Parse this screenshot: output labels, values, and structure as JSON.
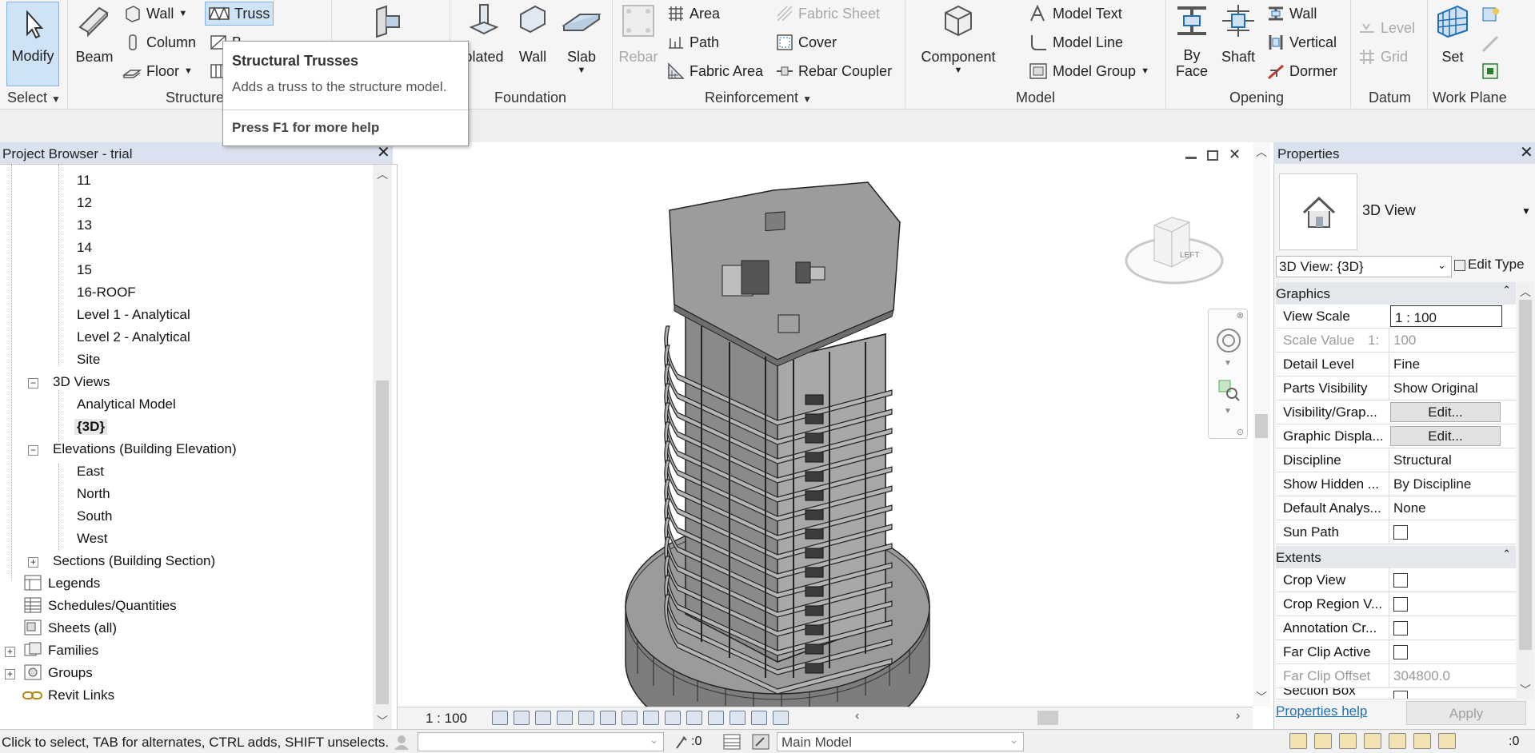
{
  "ribbon": {
    "select": {
      "modify_label": "Modify",
      "panel_label": "Select"
    },
    "structure": {
      "beam_label": "Beam",
      "wall_label": "Wall",
      "column_label": "Column",
      "floor_label": "Floor",
      "truss_label": "Truss",
      "brace_label_partial": "B",
      "panel_label": "Structure"
    },
    "foundation": {
      "isolated_label": "olated",
      "wall_label": "Wall",
      "slab_label": "Slab",
      "panel_label": "Foundation"
    },
    "reinforcement": {
      "rebar_label": "Rebar",
      "area_label": "Area",
      "path_label": "Path",
      "fabric_area_label": "Fabric  Area",
      "fabric_sheet_label": "Fabric  Sheet",
      "cover_label": "Cover",
      "rebar_coupler_label": "Rebar  Coupler",
      "panel_label": "Reinforcement"
    },
    "model": {
      "component_label": "Component",
      "model_text_label": "Model  Text",
      "model_line_label": "Model  Line",
      "model_group_label": "Model  Group",
      "panel_label": "Model"
    },
    "opening": {
      "by_face_label1": "By",
      "by_face_label2": "Face",
      "shaft_label": "Shaft",
      "wall_label": "Wall",
      "vertical_label": "Vertical",
      "dormer_label": "Dormer",
      "panel_label": "Opening"
    },
    "datum": {
      "level_label": "Level",
      "grid_label": "Grid",
      "panel_label": "Datum"
    },
    "workplane": {
      "set_label": "Set",
      "panel_label": "Work Plane"
    }
  },
  "tooltip": {
    "title": "Structural Trusses",
    "description": "Adds a truss to the structure model.",
    "help": "Press F1 for more help"
  },
  "browser": {
    "title": "Project Browser - trial",
    "levels": [
      "11",
      "12",
      "13",
      "14",
      "15",
      "16-ROOF",
      "Level 1 - Analytical",
      "Level 2 - Analytical",
      "Site"
    ],
    "views3d_label": "3D Views",
    "views3d": [
      "Analytical Model",
      "{3D}"
    ],
    "elevations_label": "Elevations (Building Elevation)",
    "elevations": [
      "East",
      "North",
      "South",
      "West"
    ],
    "sections_label": "Sections (Building Section)",
    "legends_label": "Legends",
    "schedules_label": "Schedules/Quantities",
    "sheets_label": "Sheets (all)",
    "families_label": "Families",
    "groups_label": "Groups",
    "links_label": "Revit Links"
  },
  "viewcube": {
    "face_label": "LEFT"
  },
  "viewbar": {
    "scale": "1 : 100"
  },
  "properties": {
    "title": "Properties",
    "type_name": "3D View",
    "instance_selector": "3D View: {3D}",
    "edit_type_label": "Edit Type",
    "graphics_label": "Graphics",
    "rows": {
      "view_scale": {
        "name": "View Scale",
        "value": "1 : 100"
      },
      "scale_value": {
        "name": "Scale Value",
        "prefix": "1:",
        "value": "100"
      },
      "detail_level": {
        "name": "Detail Level",
        "value": "Fine"
      },
      "parts_visibility": {
        "name": "Parts Visibility",
        "value": "Show Original"
      },
      "visibility_graphics": {
        "name": "Visibility/Grap...",
        "value": "Edit..."
      },
      "graphic_display": {
        "name": "Graphic Displa...",
        "value": "Edit..."
      },
      "discipline": {
        "name": "Discipline",
        "value": "Structural"
      },
      "show_hidden": {
        "name": "Show Hidden ...",
        "value": "By Discipline"
      },
      "default_analysis": {
        "name": "Default Analys...",
        "value": "None"
      },
      "sun_path": {
        "name": "Sun Path",
        "checked": false
      }
    },
    "extents_label": "Extents",
    "extents": {
      "crop_view": {
        "name": "Crop View",
        "checked": false
      },
      "crop_region": {
        "name": "Crop Region V...",
        "checked": false
      },
      "annotation_crop": {
        "name": "Annotation Cr...",
        "checked": false
      },
      "far_clip_active": {
        "name": "Far Clip Active",
        "checked": false
      },
      "far_clip_offset": {
        "name": "Far Clip Offset",
        "value": "304800.0"
      },
      "section_box": {
        "name": "Section Box"
      }
    },
    "help_link": "Properties help",
    "apply_label": "Apply"
  },
  "status": {
    "message": "Click to select, TAB for alternates, CTRL adds, SHIFT unselects.",
    "count": ":0",
    "model": "Main Model",
    "filter_count": ":0"
  },
  "colors": {
    "accent": "#1e6fb8",
    "selected": "#cfe3f7",
    "panel_head": "#d9e2ee",
    "model_gray": "#9b9b9b"
  }
}
